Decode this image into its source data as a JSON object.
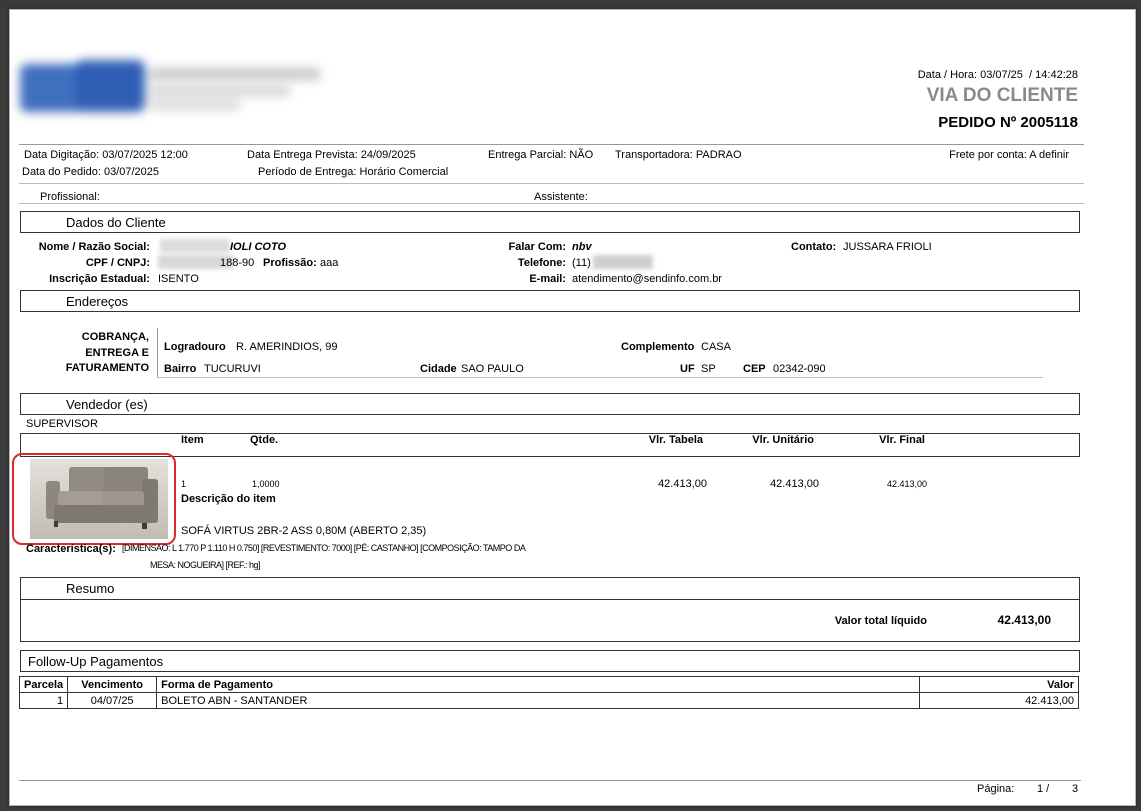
{
  "header": {
    "datetime_label": "Data / Hora:",
    "date": "03/07/25",
    "time_sep": "/",
    "time": "14:42:28",
    "copy_label": "VIA DO CLIENTE",
    "order_label": "PEDIDO Nº 2005118"
  },
  "order_info": {
    "data_digitacao": "Data Digitação: 03/07/2025 12:00",
    "data_pedido": "Data do Pedido: 03/07/2025",
    "entrega_prevista": "Data Entrega Prevista: 24/09/2025",
    "periodo_label": "Período de Entrega:",
    "periodo_value": "Horário Comercial",
    "entrega_parcial": "Entrega Parcial: NÃO",
    "transportadora": "Transportadora: PADRAO",
    "frete": "Frete por conta: A definir",
    "profissional": "Profissional:",
    "assistente": "Assistente:"
  },
  "cliente": {
    "section_title": "Dados do Cliente",
    "nome_label": "Nome / Razão Social:",
    "nome_value": "IOLI COTO",
    "cpf_label": "CPF / CNPJ:",
    "cpf_value": "188-90",
    "profissao_label": "Profissão:",
    "profissao_value": "aaa",
    "ie_label": "Inscrição Estadual:",
    "ie_value": "ISENTO",
    "falar_label": "Falar Com:",
    "falar_value": "nbv",
    "telefone_label": "Telefone:",
    "telefone_value": "(11)",
    "email_label": "E-mail:",
    "email_value": "atendimento@sendinfo.com.br",
    "contato_label": "Contato:",
    "contato_value": "JUSSARA FRIOLI"
  },
  "enderecos": {
    "section_title": "Endereços",
    "tipo_l1": "COBRANÇA,",
    "tipo_l2": "ENTREGA E",
    "tipo_l3": "FATURAMENTO",
    "logradouro_label": "Logradouro",
    "logradouro_value": "R. AMERINDIOS, 99",
    "complemento_label": "Complemento",
    "complemento_value": "CASA",
    "bairro_label": "Bairro",
    "bairro_value": "TUCURUVI",
    "cidade_label": "Cidade",
    "cidade_value": "SAO PAULO",
    "uf_label": "UF",
    "uf_value": "SP",
    "cep_label": "CEP",
    "cep_value": "02342-090"
  },
  "vendedor": {
    "section_title": "Vendedor (es)",
    "name": "SUPERVISOR"
  },
  "items_header": {
    "item": "Item",
    "qtde": "Qtde.",
    "vlr_tabela": "Vlr. Tabela",
    "vlr_unitario": "Vlr. Unitário",
    "vlr_final": "Vlr. Final"
  },
  "item": {
    "number": "1",
    "qtde": "1,0000",
    "vlr_tabela": "42.413,00",
    "vlr_unitario": "42.413,00",
    "vlr_final": "42.413,00",
    "desc_label": "Descrição do item",
    "desc_value": "SOFÁ VIRTUS 2BR-2 ASS 0,80M (ABERTO 2,35)",
    "carac_label": "Característica(s):",
    "carac_l1": "[DIMENSAO: L 1.770 P 1.110 H 0.750] [REVESTIMENTO: 7000] [PÉ: CASTANHO] [COMPOSIÇÃO: TAMPO DA",
    "carac_l2": "MESA: NOGUEIRA]  [REF.: hg]"
  },
  "resumo": {
    "section_title": "Resumo",
    "total_label": "Valor total líquido",
    "total_value": "42.413,00"
  },
  "pagamentos": {
    "section_title": "Follow-Up Pagamentos",
    "col_parcela": "Parcela",
    "col_vencimento": "Vencimento",
    "col_forma": "Forma de Pagamento",
    "col_valor": "Valor",
    "rows": [
      {
        "parcela": "1",
        "vencimento": "04/07/25",
        "forma": "BOLETO ABN - SANTANDER",
        "valor": "42.413,00"
      }
    ]
  },
  "footer": {
    "pagina_label": "Página:",
    "pagina_atual": "1 /",
    "pagina_total": "3"
  }
}
